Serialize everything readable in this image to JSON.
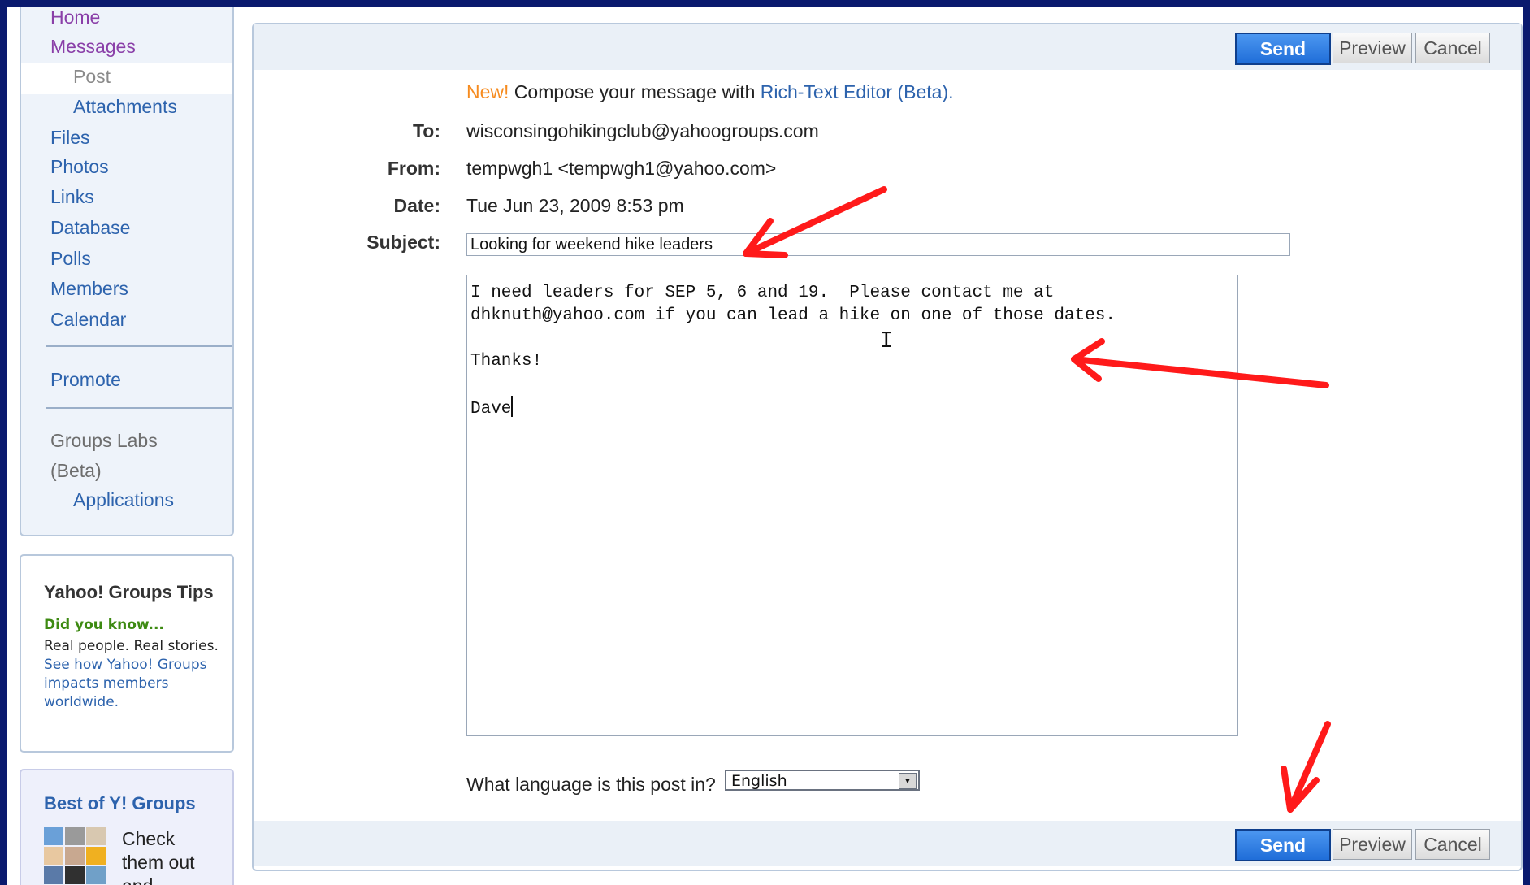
{
  "sidebar": {
    "items": [
      {
        "label": "Home"
      },
      {
        "label": "Messages"
      },
      {
        "label": "Post"
      },
      {
        "label": "Attachments"
      },
      {
        "label": "Files"
      },
      {
        "label": "Photos"
      },
      {
        "label": "Links"
      },
      {
        "label": "Database"
      },
      {
        "label": "Polls"
      },
      {
        "label": "Members"
      },
      {
        "label": "Calendar"
      },
      {
        "label": "Promote"
      },
      {
        "label": "Groups Labs"
      },
      {
        "label": "(Beta)"
      },
      {
        "label": "Applications"
      }
    ]
  },
  "tips": {
    "title": "Yahoo! Groups Tips",
    "did_you_know": "Did you know...",
    "body_text": "Real people. Real stories.",
    "link_text": "See how Yahoo! Groups impacts members worldwide."
  },
  "best": {
    "title": "Best of Y! Groups",
    "text": "Check them out and"
  },
  "toolbar": {
    "send_label": "Send",
    "preview_label": "Preview",
    "cancel_label": "Cancel"
  },
  "compose": {
    "rte_new": "New!",
    "rte_text": " Compose your message with ",
    "rte_link": "Rich-Text Editor (Beta).",
    "to_label": "To:",
    "to_value": "wisconsingohikingclub@yahoogroups.com",
    "from_label": "From:",
    "from_value": "tempwgh1 <tempwgh1@yahoo.com>",
    "date_label": "Date:",
    "date_value": "Tue Jun 23, 2009 8:53 pm",
    "subject_label": "Subject:",
    "subject_value": "Looking for weekend hike leaders",
    "body_lines": [
      "I need leaders for SEP 5, 6 and 19.  Please contact me at",
      "dhknuth@yahoo.com if you can lead a hike on one of those dates.",
      "",
      "Thanks!",
      "",
      "Dave"
    ],
    "language_label": "What language is this post in?",
    "language_value": "English"
  },
  "colors": {
    "background": "#0a1a6e",
    "link": "#2d63ad",
    "send": "#1f6dd8",
    "annotation_arrow": "#ff1a1a"
  }
}
